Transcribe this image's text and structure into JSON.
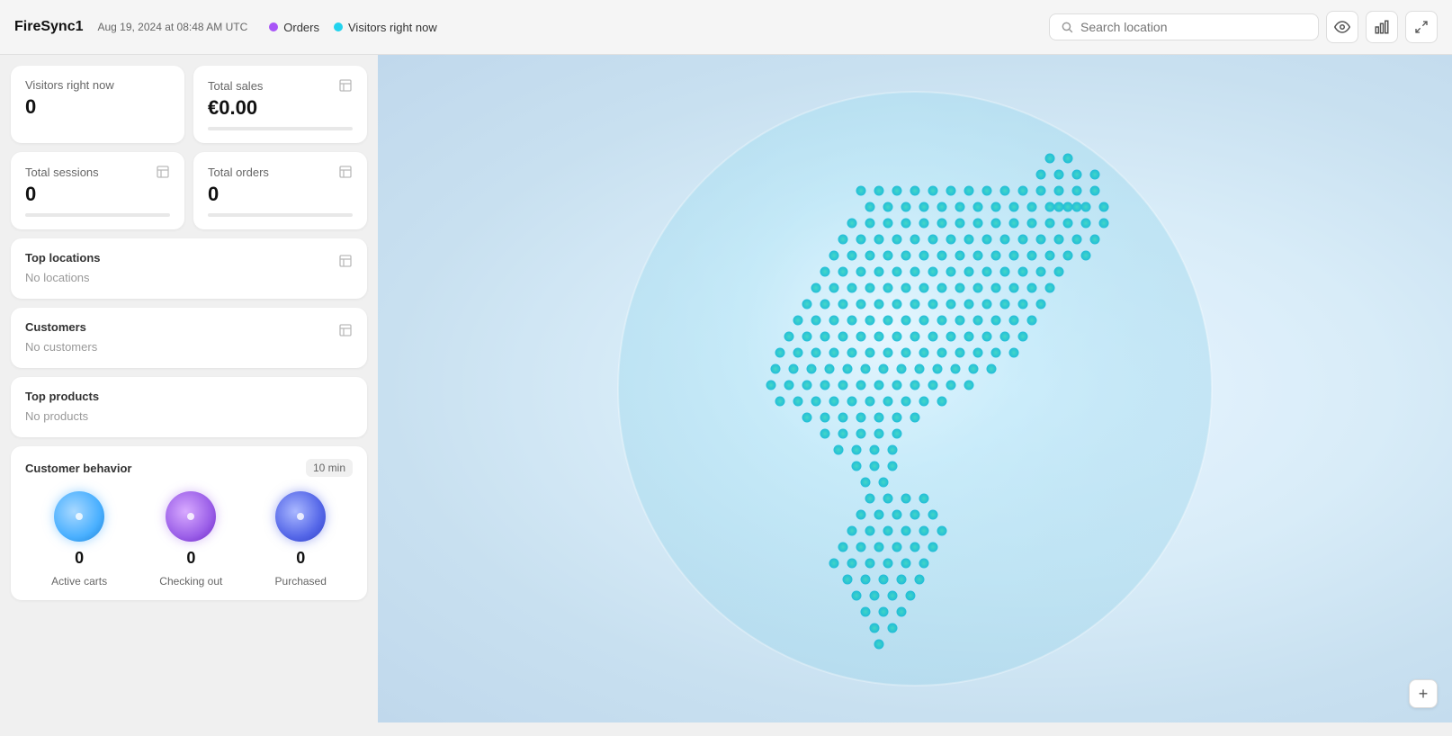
{
  "header": {
    "app_title": "FireSync1",
    "date": "Aug 19, 2024 at 08:48 AM UTC",
    "legend": [
      {
        "label": "Orders",
        "color": "#a855f7",
        "type": "orders"
      },
      {
        "label": "Visitors right now",
        "color": "#22d3ee",
        "type": "visitors"
      }
    ],
    "search_placeholder": "Search location",
    "icons": {
      "eye": "👁",
      "bar_chart": "📊",
      "expand": "⤢"
    }
  },
  "sidebar": {
    "visitors_right_now": {
      "label": "Visitors right now",
      "value": "0"
    },
    "total_sales": {
      "label": "Total sales",
      "value": "€0.00"
    },
    "total_sessions": {
      "label": "Total sessions",
      "value": "0"
    },
    "total_orders": {
      "label": "Total orders",
      "value": "0"
    },
    "top_locations": {
      "title": "Top locations",
      "empty": "No locations"
    },
    "customers": {
      "title": "Customers",
      "empty": "No customers"
    },
    "top_products": {
      "title": "Top products",
      "empty": "No products"
    },
    "customer_behavior": {
      "title": "Customer behavior",
      "badge": "10 min",
      "items": [
        {
          "label": "Active carts",
          "count": "0",
          "bubble_type": "blue"
        },
        {
          "label": "Checking out",
          "count": "0",
          "bubble_type": "purple"
        },
        {
          "label": "Purchased",
          "count": "0",
          "bubble_type": "indigo"
        }
      ]
    }
  },
  "map": {
    "plus_label": "+"
  }
}
